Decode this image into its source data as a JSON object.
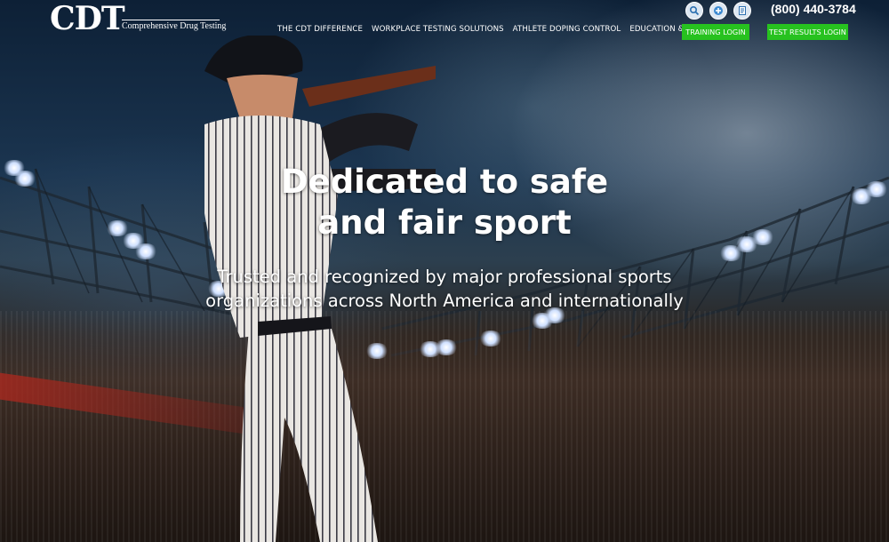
{
  "brand": {
    "logo_mark": "CDT",
    "logo_subtitle": "Comprehensive Drug Testing"
  },
  "nav": {
    "items": [
      {
        "label": "THE CDT DIFFERENCE"
      },
      {
        "label": "WORKPLACE TESTING SOLUTIONS"
      },
      {
        "label": "ATHLETE DOPING CONTROL"
      },
      {
        "label": "EDUCATION & RESOURCES"
      }
    ]
  },
  "utility": {
    "icons": [
      "search-icon",
      "plus-icon",
      "document-icon"
    ],
    "phone": "(800) 440-3784",
    "training_login": "TRAINING LOGIN",
    "test_results_login": "TEST RESULTS LOGIN"
  },
  "hero": {
    "headline_line1": "Dedicated to safe",
    "headline_line2": "and fair sport",
    "sub_line1": "Trusted and recognized by major professional sports",
    "sub_line2": "organizations across North America and internationally"
  },
  "colors": {
    "button_green": "#27c21f",
    "text": "#ffffff",
    "icon_bg": "#dde7f2"
  }
}
